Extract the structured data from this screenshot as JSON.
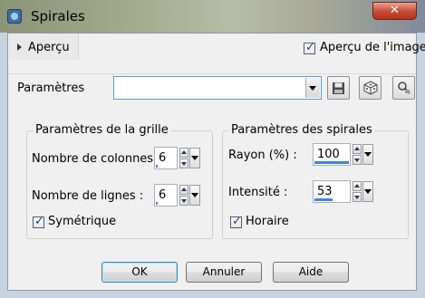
{
  "window": {
    "title": "Spirales",
    "close_symbol": "✕"
  },
  "preview": {
    "label": "Aperçu",
    "image_preview_label": "Aperçu de l'image",
    "image_preview_checked": true
  },
  "presets": {
    "label": "Paramètres",
    "value": ""
  },
  "grid": {
    "title": "Paramètres de la grille",
    "columns_label": "Nombre de colonnes :",
    "columns_value": "6",
    "columns_fraction": 0.06,
    "rows_label": "Nombre de lignes :",
    "rows_value": "6",
    "rows_fraction": 0.06,
    "symmetric_label": "Symétrique",
    "symmetric_checked": true
  },
  "spirals": {
    "title": "Paramètres des spirales",
    "radius_label": "Rayon (%) :",
    "radius_value": "100",
    "radius_fraction": 1.0,
    "intensity_label": "Intensité :",
    "intensity_value": "53",
    "intensity_fraction": 0.53,
    "clockwise_label": "Horaire",
    "clockwise_checked": true
  },
  "buttons": {
    "ok": "OK",
    "cancel": "Annuler",
    "help": "Aide"
  }
}
